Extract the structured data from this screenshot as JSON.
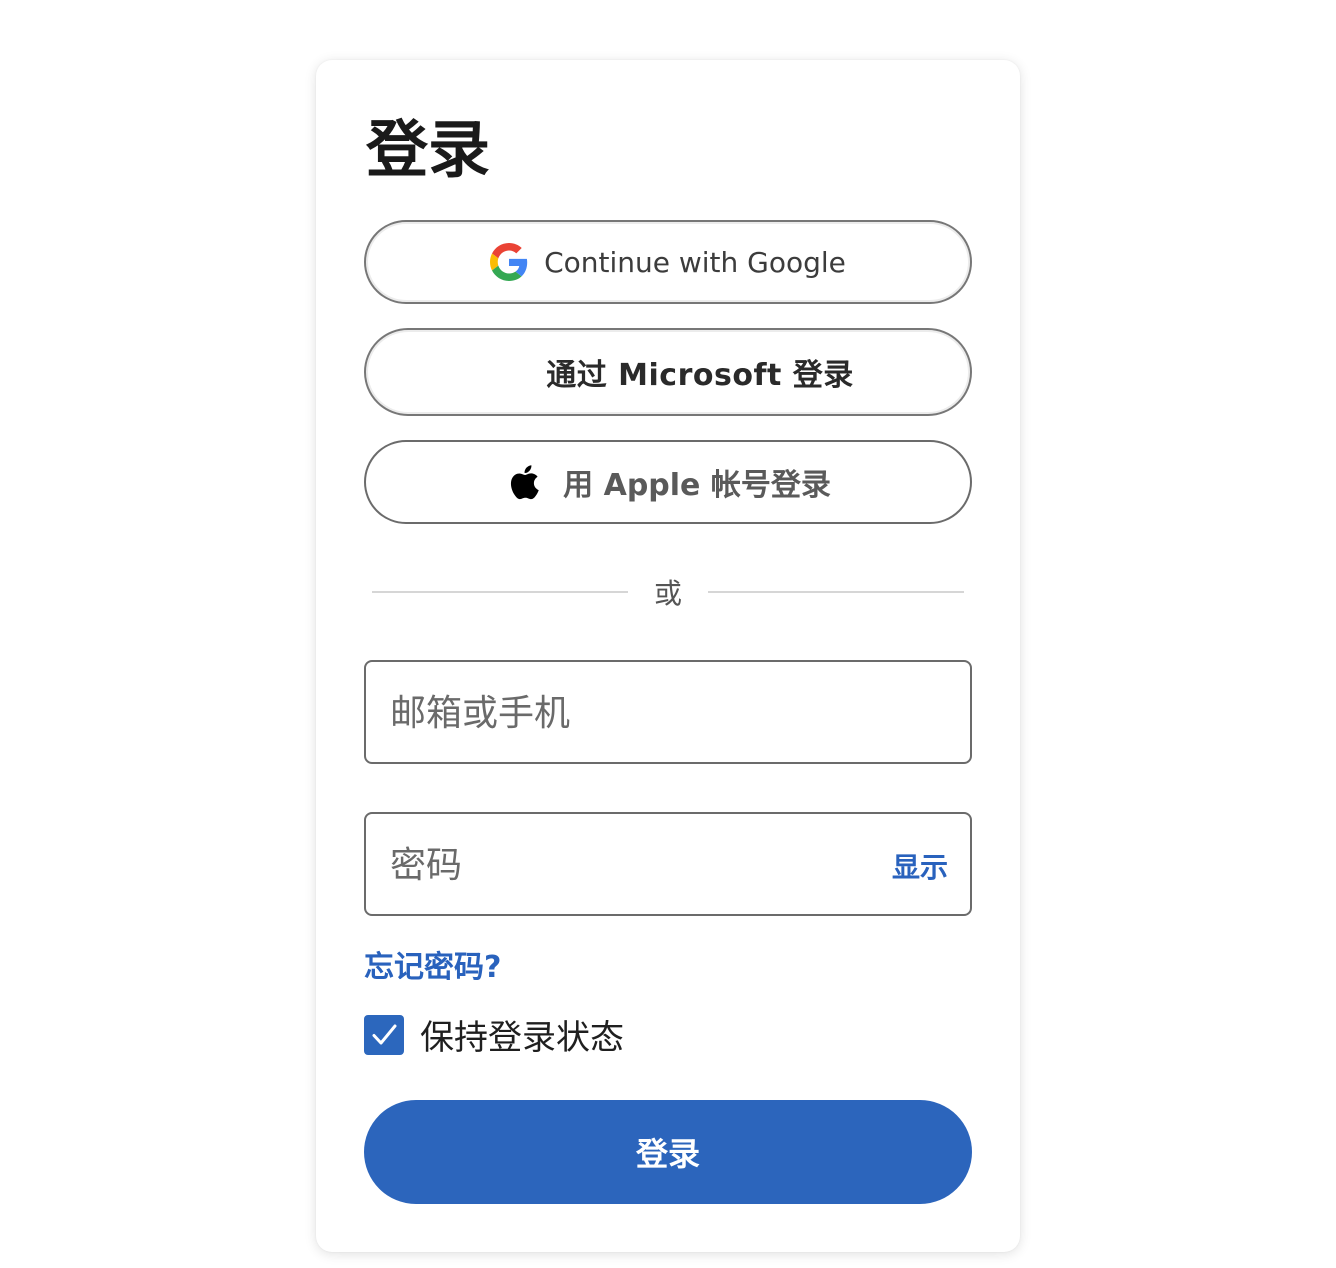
{
  "title": "登录",
  "sso": {
    "google_label": "Continue with Google",
    "microsoft_label": "通过 Microsoft 登录",
    "apple_label": "用 Apple 帐号登录"
  },
  "divider_text": "或",
  "email_field": {
    "placeholder": "邮箱或手机",
    "value": ""
  },
  "password_field": {
    "placeholder": "密码",
    "value": "",
    "show_label": "显示"
  },
  "forgot_password": "忘记密码?",
  "remember": {
    "label": "保持登录状态",
    "checked": true
  },
  "submit_label": "登录",
  "colors": {
    "accent": "#2C65BC",
    "link": "#2962BD",
    "microsoft": [
      "#F25022",
      "#7FBA00",
      "#00A4EF",
      "#FFB900"
    ]
  },
  "icons": [
    "google-icon",
    "microsoft-icon",
    "apple-icon",
    "checkmark-icon"
  ]
}
